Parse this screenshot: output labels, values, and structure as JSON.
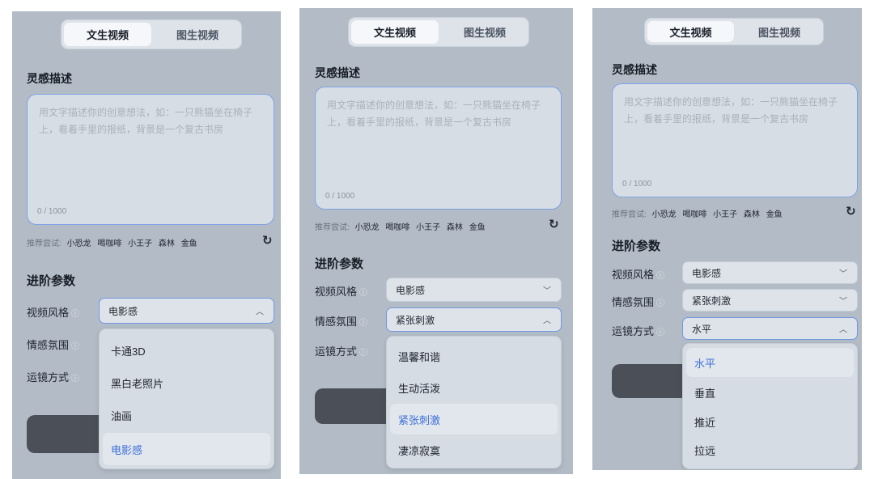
{
  "tabs": {
    "text_to_video": "文生视频",
    "image_to_video": "图生视频"
  },
  "inspiration": {
    "label": "灵感描述",
    "placeholder": "用文字描述你的创意想法，如：一只熊猫坐在椅子上，看着手里的报纸，背景是一个复古书房",
    "count": "0 / 1000"
  },
  "suggestions": {
    "prefix": "推荐尝试:",
    "tags": [
      "小恐龙",
      "喝咖啡",
      "小王子",
      "森林",
      "金鱼"
    ],
    "refresh_icon": "↻"
  },
  "advanced": {
    "title": "进阶参数",
    "video_style_label": "视频风格",
    "mood_label": "情感氛围",
    "camera_label": "运镜方式",
    "info_icon": "ⓘ"
  },
  "panels": [
    {
      "video_style": "电影感",
      "open": "video_style",
      "options": [
        "卡通3D",
        "黑白老照片",
        "油画",
        "电影感"
      ],
      "selected_option": "电影感"
    },
    {
      "video_style": "电影感",
      "mood": "紧张刺激",
      "open": "mood",
      "options": [
        "温馨和谐",
        "生动活泼",
        "紧张刺激",
        "凄凉寂寞"
      ],
      "selected_option": "紧张刺激"
    },
    {
      "video_style": "电影感",
      "mood": "紧张刺激",
      "camera": "水平",
      "open": "camera",
      "options": [
        "水平",
        "垂直",
        "推近",
        "拉远"
      ],
      "selected_option": "水平"
    }
  ],
  "icons": {
    "chevron_down": "﹀",
    "chevron_up": "︿",
    "info": "info-icon",
    "refresh": "refresh-icon"
  },
  "colors": {
    "panel_bg": "#b3bcc6",
    "accent": "#3d6fd8",
    "button": "#4a4f58"
  }
}
